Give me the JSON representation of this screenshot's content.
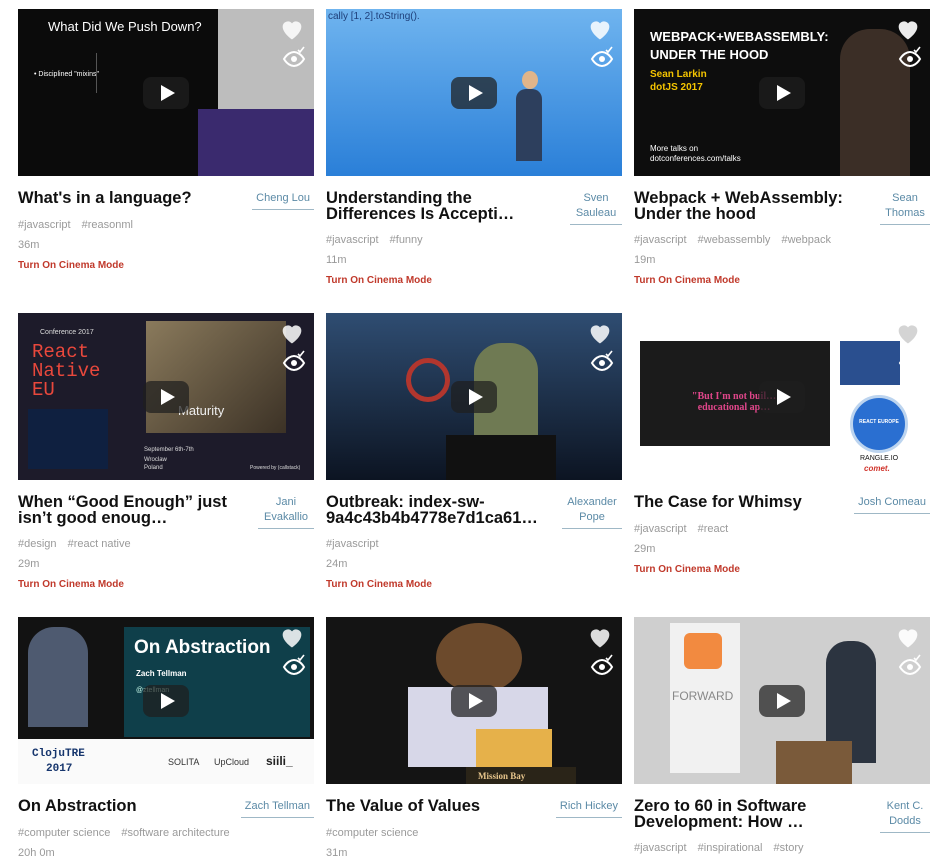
{
  "colors": {
    "accent": "#c0392b",
    "speaker": "#5b8aa6",
    "tag": "#9a9a9a"
  },
  "icons": {
    "heart": "heart-icon",
    "watched": "eye-check-icon",
    "play": "play-icon"
  },
  "cards": [
    {
      "title": "What's in a language?",
      "speaker": "Cheng Lou",
      "tags": [
        "#javascript",
        "#reasonml"
      ],
      "duration": "36m",
      "cinema": "Turn On Cinema Mode",
      "slide": [
        "What Did We Push Down?",
        "• Disciplined \"mixins\""
      ]
    },
    {
      "title": "Understanding the Differences Is Accepti…",
      "speaker": "Sven Sauleau",
      "tags": [
        "#javascript",
        "#funny"
      ],
      "duration": "11m",
      "cinema": "Turn On Cinema Mode",
      "slide": [
        "cally [1, 2].toString()."
      ]
    },
    {
      "title": "Webpack + WebAssembly: Under the hood",
      "speaker": "Sean Thomas",
      "tags": [
        "#javascript",
        "#webassembly",
        "#webpack"
      ],
      "duration": "19m",
      "cinema": "Turn On Cinema Mode",
      "slide": [
        "WEBPACK+WEBASSEMBLY:",
        "UNDER THE HOOD",
        "Sean Larkin",
        "dotJS 2017",
        "More talks on",
        "dotconferences.com/talks"
      ]
    },
    {
      "title": "When “Good Enough” just isn’t good enoug…",
      "speaker": "Jani Evakallio",
      "tags": [
        "#design",
        "#react native"
      ],
      "duration": "29m",
      "cinema": "Turn On Cinema Mode",
      "slide": [
        "Conference 2017",
        "React",
        "Native",
        "EU",
        "Maturity",
        "September 6th-7th",
        "Wroclaw",
        "Poland",
        "Powered by (callstack)"
      ]
    },
    {
      "title": "Outbreak: index-sw-9a4c43b4b4778e7d1ca61…",
      "speaker": "Alexander Pope",
      "tags": [
        "#javascript"
      ],
      "duration": "24m",
      "cinema": "Turn On Cinema Mode",
      "slide": []
    },
    {
      "title": "The Case for Whimsy",
      "speaker": "Josh Comeau",
      "tags": [
        "#javascript",
        "#react"
      ],
      "duration": "29m",
      "cinema": "Turn On Cinema Mode",
      "slide": [
        "\"But I'm not buil… educational ap…",
        "REACT EUROPE",
        "RANGLE.IO",
        "comet."
      ]
    },
    {
      "title": "On Abstraction",
      "speaker": "Zach Tellman",
      "tags": [
        "#computer science",
        "#software architecture"
      ],
      "duration": "20h 0m",
      "cinema": "",
      "slide": [
        "On Abstraction",
        "Zach Tellman",
        "@ztellman",
        "ClojuTRE",
        "2017",
        "SOLITA",
        "UpCloud",
        "siili_"
      ]
    },
    {
      "title": "The Value of Values",
      "speaker": "Rich Hickey",
      "tags": [
        "#computer science"
      ],
      "duration": "31m",
      "cinema": "",
      "slide": [
        "Mission Bay"
      ]
    },
    {
      "title": "Zero to 60 in Software Development: How …",
      "speaker": "Kent C. Dodds",
      "tags": [
        "#javascript",
        "#inspirational",
        "#story"
      ],
      "duration": "",
      "cinema": "",
      "slide": [
        "FORWARD"
      ]
    }
  ]
}
